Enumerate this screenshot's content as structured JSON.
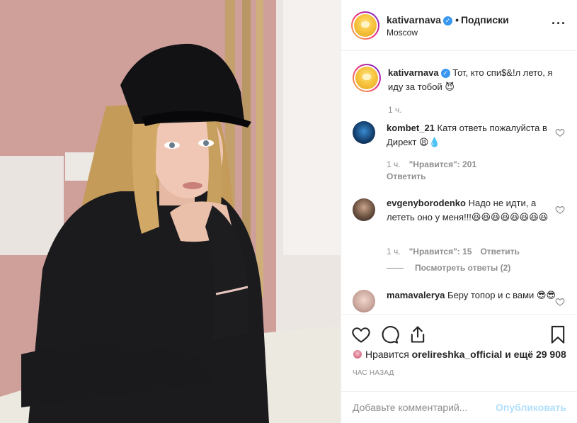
{
  "post": {
    "photo_alt": "",
    "username": "kativarnava",
    "separator": "•",
    "follow_label": "Подписки",
    "location": "Moscow",
    "more_icon": "more-horizontal-icon",
    "verified_icon": "verified-badge-icon"
  },
  "caption": {
    "username": "kativarnava",
    "text": "Тот, кто спи$&!л лето, я иду за тобой 😈",
    "time": "1 ч."
  },
  "comments": [
    {
      "username": "kombet_21",
      "text": "Катя ответь пожалуйста в Директ 😫💧",
      "time": "1 ч.",
      "likes": "\"Нравится\": 201",
      "reply": "Ответить"
    },
    {
      "username": "evgenyborodenko",
      "text": "Надо не идти, а лететь оно у меня!!!😆😆😆😆😆😆😆😆",
      "time": "1 ч.",
      "likes": "\"Нравится\": 15",
      "reply": "Ответить",
      "view_replies": "Посмотреть ответы (2)"
    },
    {
      "username": "mamavalerya",
      "text": "Беру топор и с вами 😎😎"
    }
  ],
  "actions": {
    "like_icon": "heart-icon",
    "comment_icon": "comment-icon",
    "share_icon": "share-icon",
    "save_icon": "bookmark-icon"
  },
  "likes": {
    "prefix": "Нравится",
    "user": "orelireshka_official",
    "suffix": "и ещё 29 908"
  },
  "time_ago": "ЧАС НАЗАД",
  "add_comment": {
    "placeholder": "Добавьте комментарий...",
    "publish": "Опубликовать"
  },
  "colors": {
    "accent": "#3897f0",
    "publish_disabled": "#b2dffc",
    "muted": "#8e8e8e"
  }
}
